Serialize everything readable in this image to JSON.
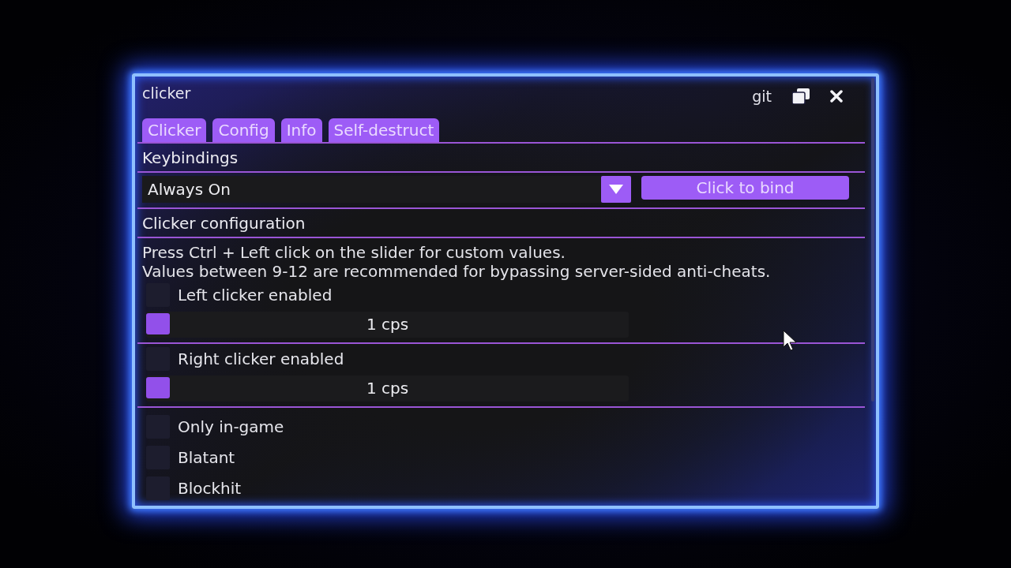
{
  "window": {
    "title": "clicker",
    "link": "git"
  },
  "tabs": [
    {
      "label": "Clicker"
    },
    {
      "label": "Config"
    },
    {
      "label": "Info"
    },
    {
      "label": "Self-destruct"
    }
  ],
  "panels": [
    {
      "kind": "header",
      "label": "Keybindings"
    },
    {
      "kind": "bind",
      "dropdown": {
        "value": "Always On"
      },
      "button": "Click to bind"
    },
    {
      "kind": "header",
      "label": "Clicker configuration"
    },
    {
      "kind": "note",
      "lines": [
        "Press Ctrl + Left click on the slider for custom values.",
        "Values between 9-12 are recommended for bypassing server-sided anti-cheats."
      ]
    },
    {
      "kind": "clicker",
      "checkbox": {
        "label": "Left clicker enabled",
        "checked": false
      },
      "slider": {
        "level": 0,
        "reading": "1 cps"
      }
    },
    {
      "kind": "clicker",
      "checkbox": {
        "label": "Right clicker enabled",
        "checked": false
      },
      "slider": {
        "level": 0,
        "reading": "1 cps"
      }
    },
    {
      "kind": "options",
      "items": [
        {
          "label": "Only in-game",
          "checked": false
        },
        {
          "label": "Blatant",
          "checked": false
        },
        {
          "label": "Blockhit",
          "checked": false
        }
      ]
    }
  ]
}
